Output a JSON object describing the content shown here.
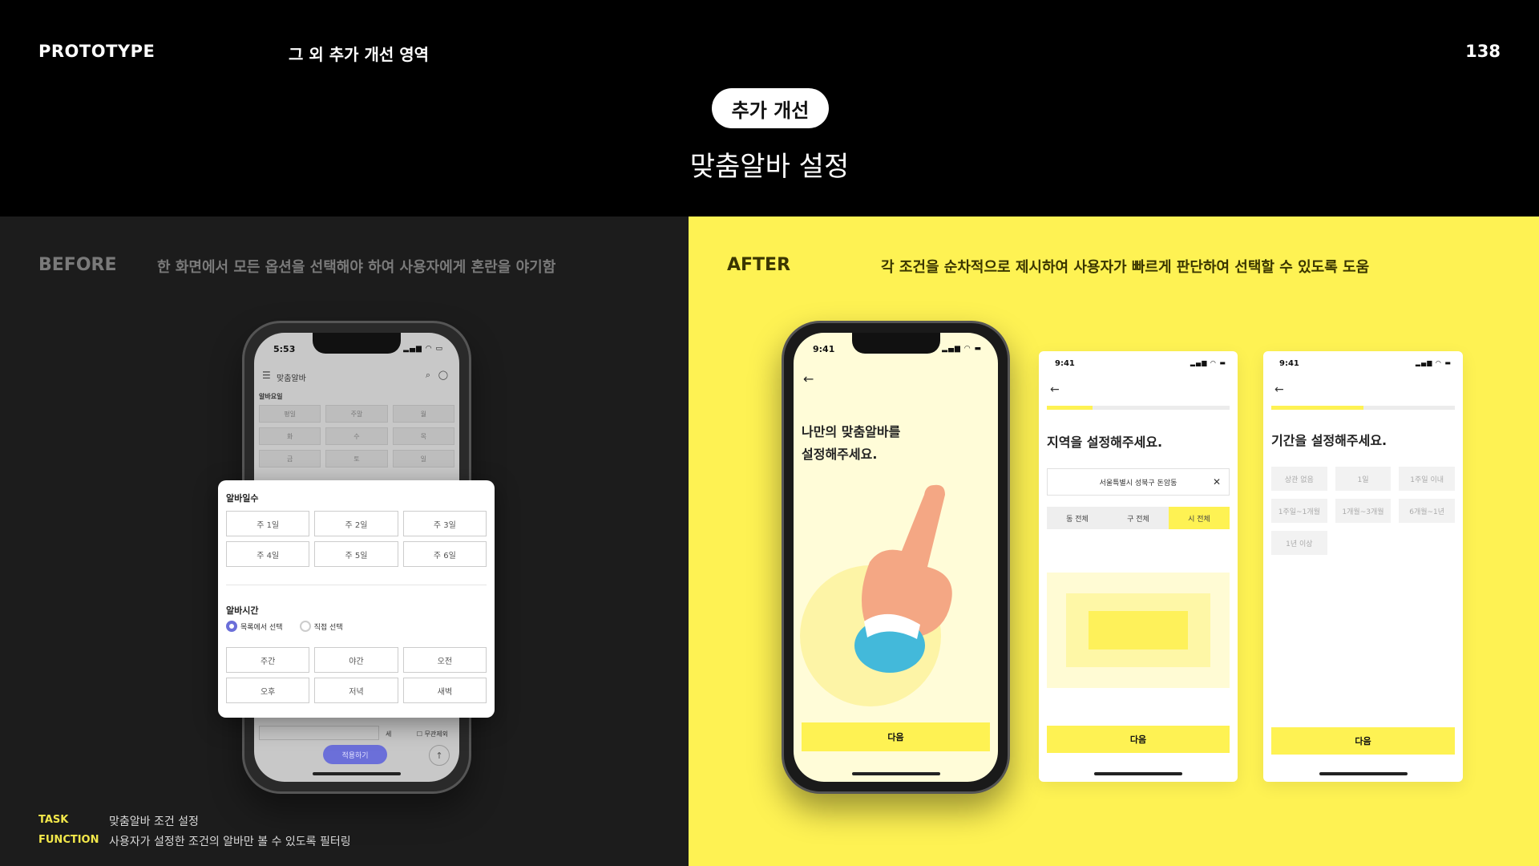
{
  "header": {
    "left": "PROTOTYPE",
    "section": "그 외 추가 개선 영역",
    "page": "138",
    "pill": "추가 개선",
    "title": "맞춤알바 설정"
  },
  "before": {
    "label": "BEFORE",
    "desc": "한 화면에서 모든 옵션을 선택해야 하여 사용자에게 혼란을 야기함",
    "phone": {
      "time": "5:53",
      "app_title": "맞춤알바",
      "section": "알바요일",
      "days": [
        [
          "평일",
          "주말",
          "월"
        ],
        [
          "화",
          "수",
          "목"
        ],
        [
          "금",
          "토",
          "일"
        ]
      ],
      "apply": "적용하기",
      "negotiable": "무관제외",
      "unit": "세"
    },
    "popup": {
      "days_title": "알바일수",
      "days": [
        "주 1일",
        "주 2일",
        "주 3일",
        "주 4일",
        "주 5일",
        "주 6일"
      ],
      "time_title": "알바시간",
      "radio_list": "목록에서 선택",
      "radio_direct": "직접 선택",
      "times": [
        "주간",
        "야간",
        "오전",
        "오후",
        "저녁",
        "새벽"
      ]
    }
  },
  "after": {
    "label": "AFTER",
    "desc": "각 조건을 순차적으로 제시하여 사용자가 빠르게 판단하여 선택할 수 있도록 도움",
    "phone1": {
      "time": "9:41",
      "heading_line1": "나만의 맞춤알바를",
      "heading_line2": "설정해주세요.",
      "next": "다음"
    },
    "phone2": {
      "time": "9:41",
      "heading": "지역을 설정해주세요.",
      "address": "서울특별시 성북구 돈암동",
      "segments": [
        "동 전체",
        "구 전체",
        "시 전체"
      ],
      "next": "다음",
      "progress": 0.25
    },
    "phone3": {
      "time": "9:41",
      "heading": "기간을 설정해주세요.",
      "options": [
        "상관 없음",
        "1일",
        "1주일 이내",
        "1주일~1개월",
        "1개월~3개월",
        "6개월~1년",
        "1년 이상"
      ],
      "next": "다음",
      "progress": 0.5
    }
  },
  "footer": {
    "task_label": "TASK",
    "task_value": "맞춤알바 조건 설정",
    "function_label": "FUNCTION",
    "function_value": "사용자가 설정한 조건의 알바만 볼 수 있도록 필터링"
  },
  "colors": {
    "accent": "#fef253",
    "panel_dark": "#1c1c1c",
    "radio": "#6b6fd9"
  }
}
